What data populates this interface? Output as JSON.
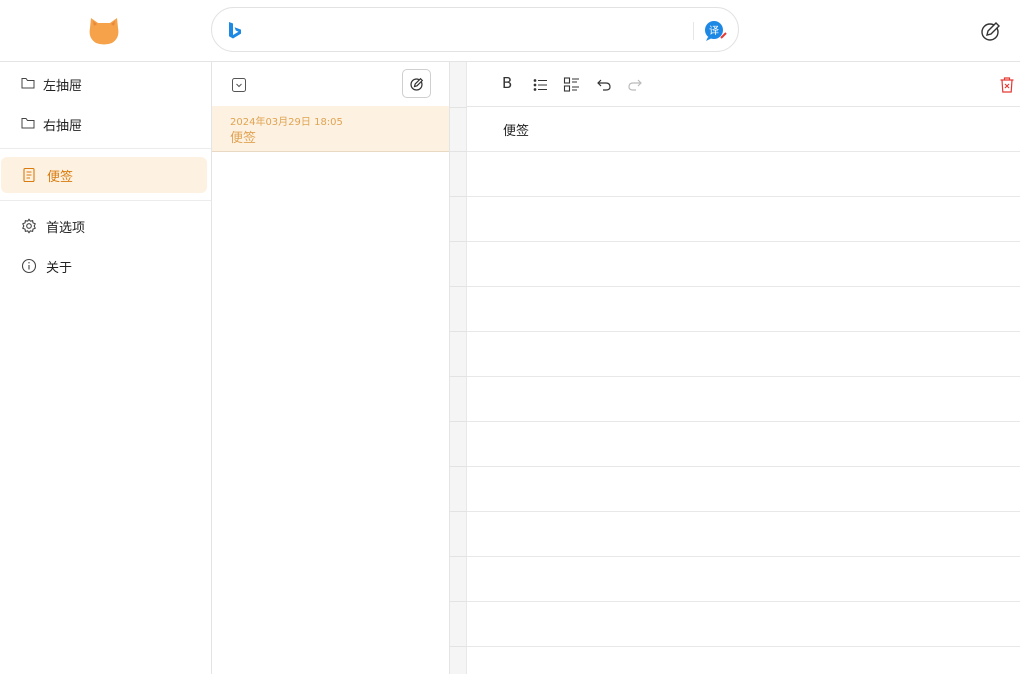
{
  "header": {
    "search_placeholder": "",
    "search_value": ""
  },
  "sidebar": {
    "items": [
      {
        "label": "左抽屉",
        "icon": "folder-icon"
      },
      {
        "label": "右抽屉",
        "icon": "folder-icon"
      },
      {
        "label": "便签",
        "icon": "note-icon",
        "active": true
      },
      {
        "label": "首选项",
        "icon": "gear-icon"
      },
      {
        "label": "关于",
        "icon": "info-icon"
      }
    ]
  },
  "note_list": {
    "notes": [
      {
        "date": "2024年03月29日 18:05",
        "title": "便签"
      }
    ]
  },
  "editor": {
    "content": "便签",
    "bold_label": "B"
  },
  "colors": {
    "accent": "#e0a352",
    "active_bg": "#fdf2e2",
    "delete": "#e53935",
    "bing_blue": "#1e88e5"
  }
}
